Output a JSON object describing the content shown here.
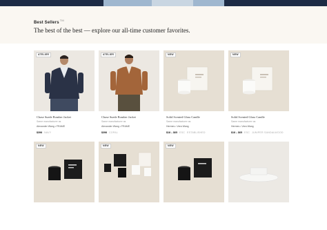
{
  "section": {
    "eyebrow": "Best Sellers",
    "eyebrow_mark": "TM",
    "headline": "The best of the best — explore our all-time customer favorites."
  },
  "products": [
    {
      "badge": "ATELIER",
      "title": "Chase Suede Bomber Jacket",
      "sub": "Same manufacturer as",
      "brand": "Alexander Wang  •  FRAME",
      "price": "$398",
      "compare": "NAVY",
      "extra": ""
    },
    {
      "badge": "ATELIER",
      "title": "Chase Suede Bomber Jacket",
      "sub": "Same manufacturer as",
      "brand": "Alexander Wang  •  FRAME",
      "price": "$398",
      "compare": "COPAL",
      "extra": ""
    },
    {
      "badge": "NEW",
      "title": "Solid Scented Glass Candle",
      "sub": "Same manufacturer as",
      "brand": "Hermes  •  Vera Wang",
      "price": "$18 – $65",
      "compare": "ESC",
      "extra": "ESTABLISHED"
    },
    {
      "badge": "NEW",
      "title": "Solid Scented Glass Candle",
      "sub": "Same manufacturer as",
      "brand": "Hermes  •  Vera Wang",
      "price": "$18 – $65",
      "compare": "ESC",
      "extra": "JUNIPER  SANDALWOOD"
    }
  ],
  "row2_badges": [
    "NEW",
    "NEW",
    "NEW"
  ],
  "colors": {
    "hero": "#1d2b45",
    "band": "#faf7f2",
    "card_bg": "#e9e3d8"
  }
}
